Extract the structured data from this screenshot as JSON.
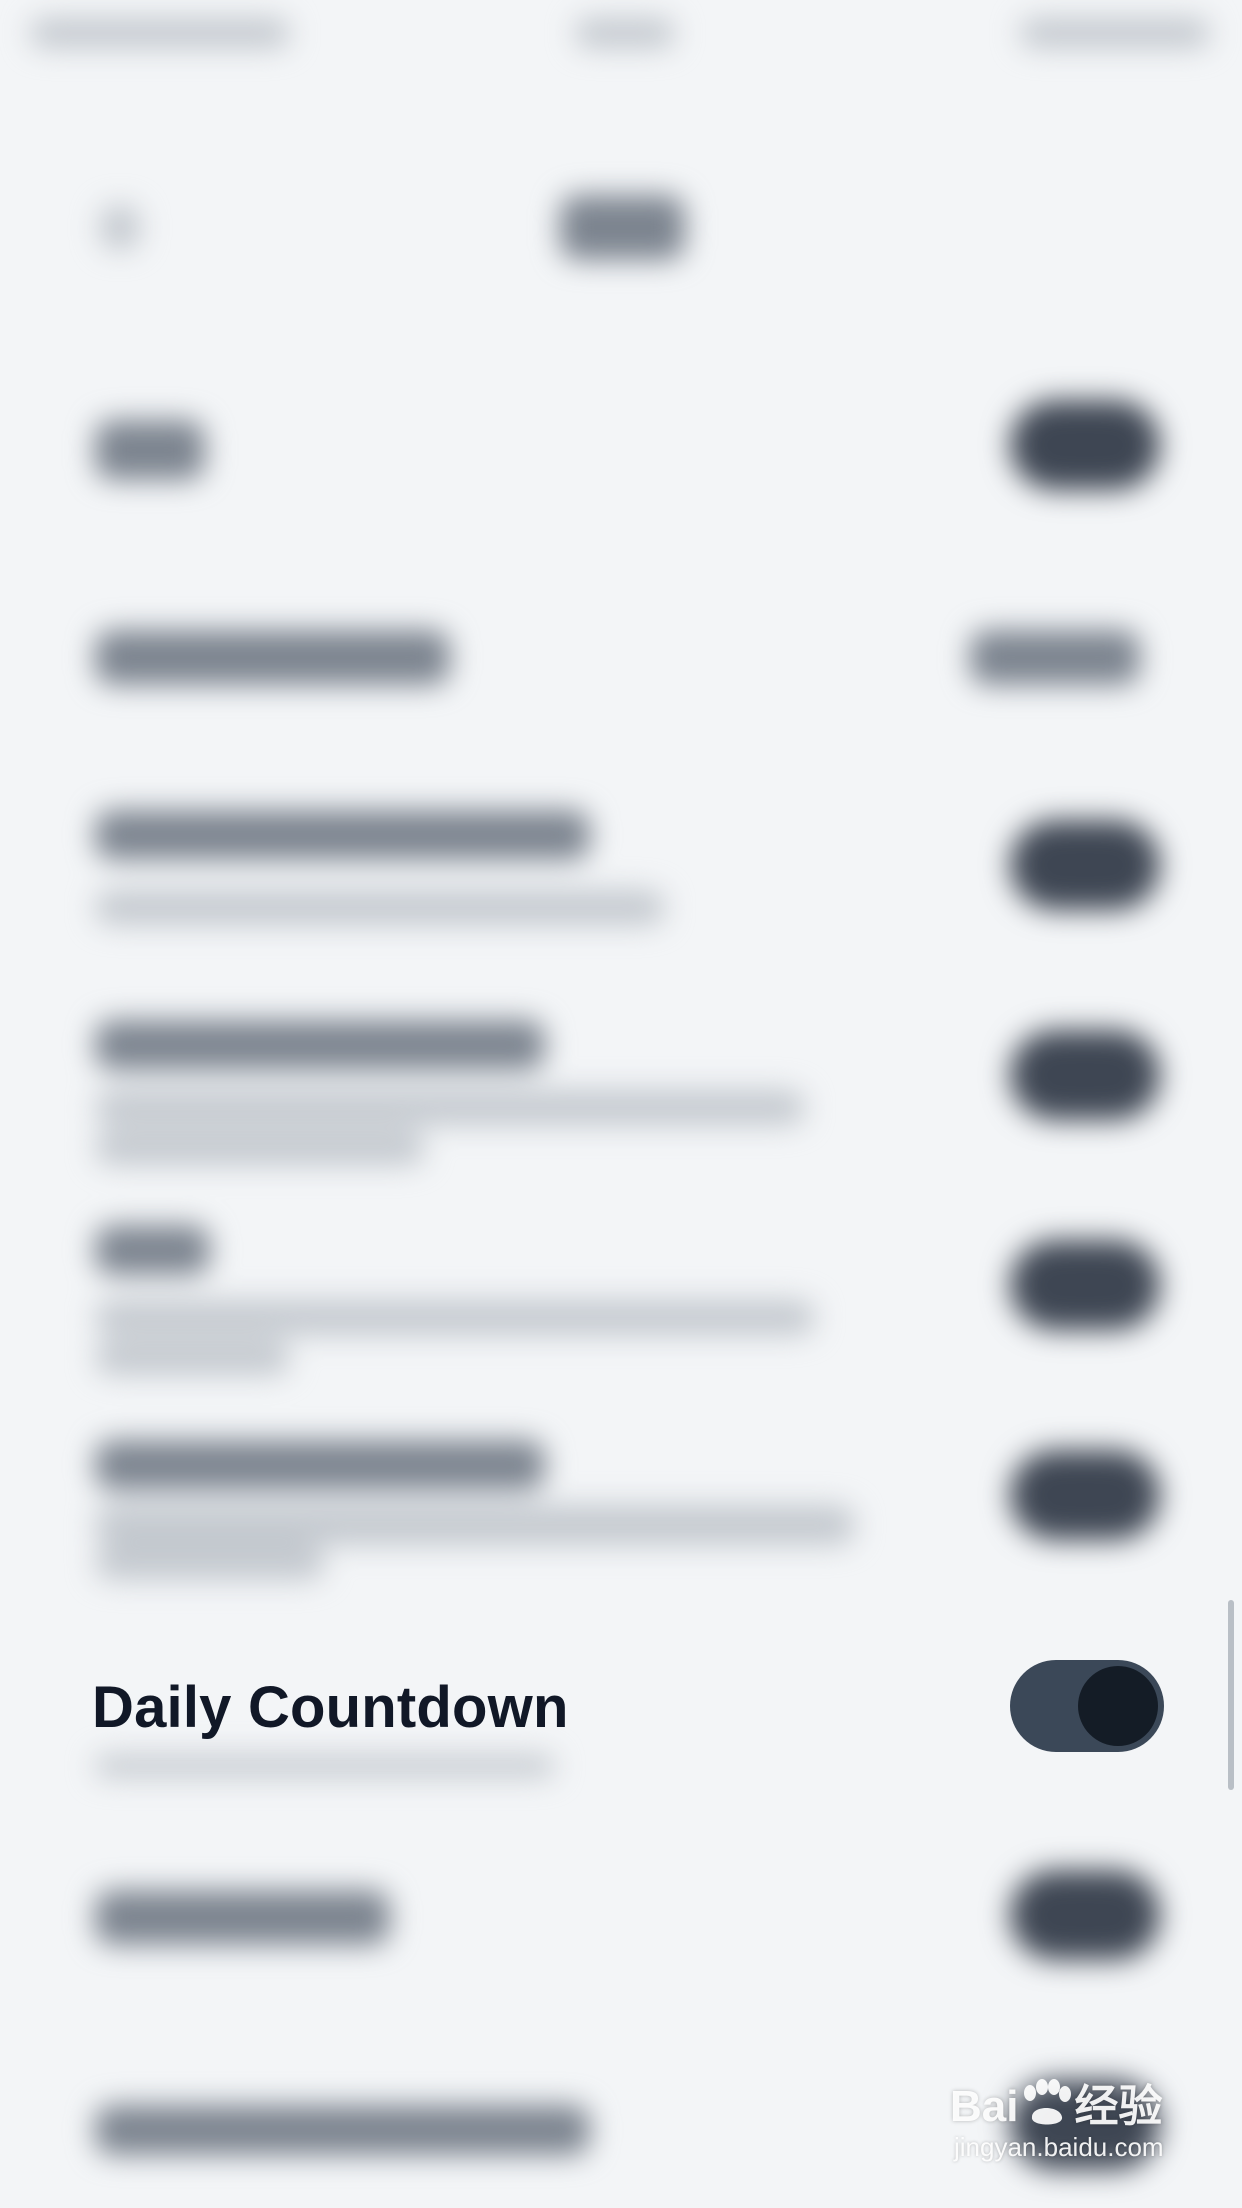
{
  "focused_setting": {
    "label": "Daily Countdown",
    "toggle_on": true
  },
  "watermark": {
    "brand_left": "Bai",
    "brand_right": "经验",
    "url": "jingyan.baidu.com"
  },
  "colors": {
    "background": "#f3f5f7",
    "label_text": "#111827",
    "toggle_track": "#3b4858",
    "toggle_knob": "#141c26"
  }
}
